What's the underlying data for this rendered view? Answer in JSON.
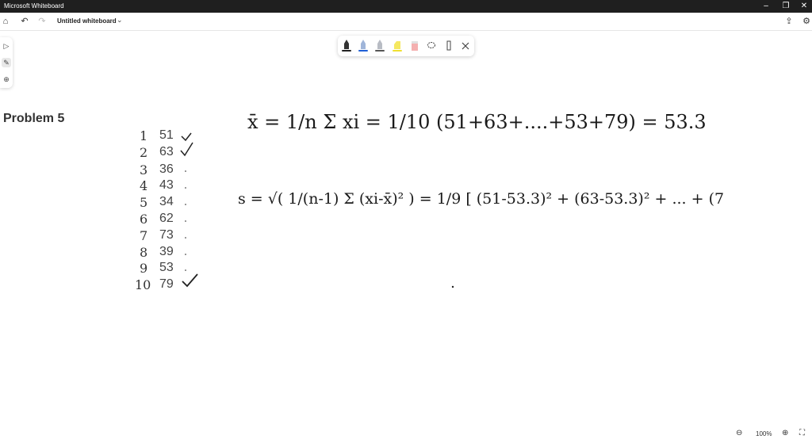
{
  "window": {
    "title": "Microsoft Whiteboard"
  },
  "appbar": {
    "doc_title": "Untitled whiteboard"
  },
  "canvas": {
    "problem_label": "Problem 5",
    "data_values": [
      "51",
      "63",
      "36",
      "43",
      "34",
      "62",
      "73",
      "39",
      "53",
      "79"
    ],
    "row_numbers": [
      "1",
      "2",
      "3",
      "4",
      "5",
      "6",
      "7",
      "8",
      "9",
      "10"
    ],
    "handwriting_line1": "x̄ = 1/n Σ xi = 1/10 (51+63+....+53+79) = 53.3",
    "handwriting_line2": "s = √( 1/(n-1) Σ (xi-x̄)² ) = 1/9 [ (51-53.3)² + (63-53.3)² + ... + (7"
  },
  "zoom": {
    "level": "100%"
  },
  "colors": {
    "titlebar_bg": "#1f1f1f",
    "ink": "#1a1a1a",
    "pen_yellow": "#f0e030",
    "pen_blue": "#1f5fd6",
    "pen_pink": "#f08080"
  },
  "icons": {
    "home": "home-icon",
    "undo": "undo-icon",
    "redo": "redo-icon",
    "share": "share-icon",
    "settings": "gear-icon",
    "select": "select-icon",
    "pen": "pen-icon",
    "add": "add-icon",
    "lasso": "lasso-icon",
    "ruler": "ruler-icon",
    "close": "close-icon",
    "zoom_out": "zoom-out-icon",
    "zoom_in": "zoom-in-icon",
    "fit": "fit-screen-icon"
  }
}
